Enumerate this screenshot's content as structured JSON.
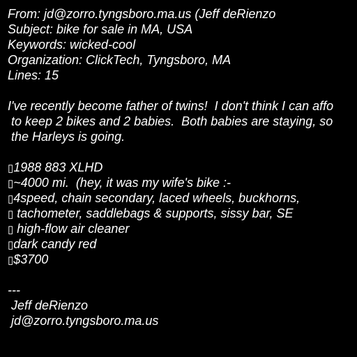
{
  "headers": {
    "from": "From: jd@zorro.tyngsboro.ma.us (Jeff deRienzo",
    "subject": "Subject: bike for sale in MA, USA",
    "keywords": "Keywords: wicked-cool",
    "organization": "Organization: ClickTech, Tyngsboro, MA",
    "lines": "Lines: 15"
  },
  "body": {
    "paragraph": [
      "I've recently become father of twins!  I don't think I can affo",
      " to keep 2 bikes and 2 babies.  Both babies are staying, so",
      " the Harleys is going."
    ],
    "bullet_glyph": "▯",
    "items": [
      "1988 883 XLHD",
      "~4000 mi.  (hey, it was my wife's bike :-",
      "4speed, chain secondary, laced wheels, buckhorns,",
      " tachometer, saddlebags & supports, sissy bar, SE",
      " high-flow air cleaner",
      "dark candy red",
      "$3700"
    ]
  },
  "signature": {
    "separator": "---",
    "name": " Jeff deRienzo",
    "email": " jd@zorro.tyngsboro.ma.us"
  }
}
